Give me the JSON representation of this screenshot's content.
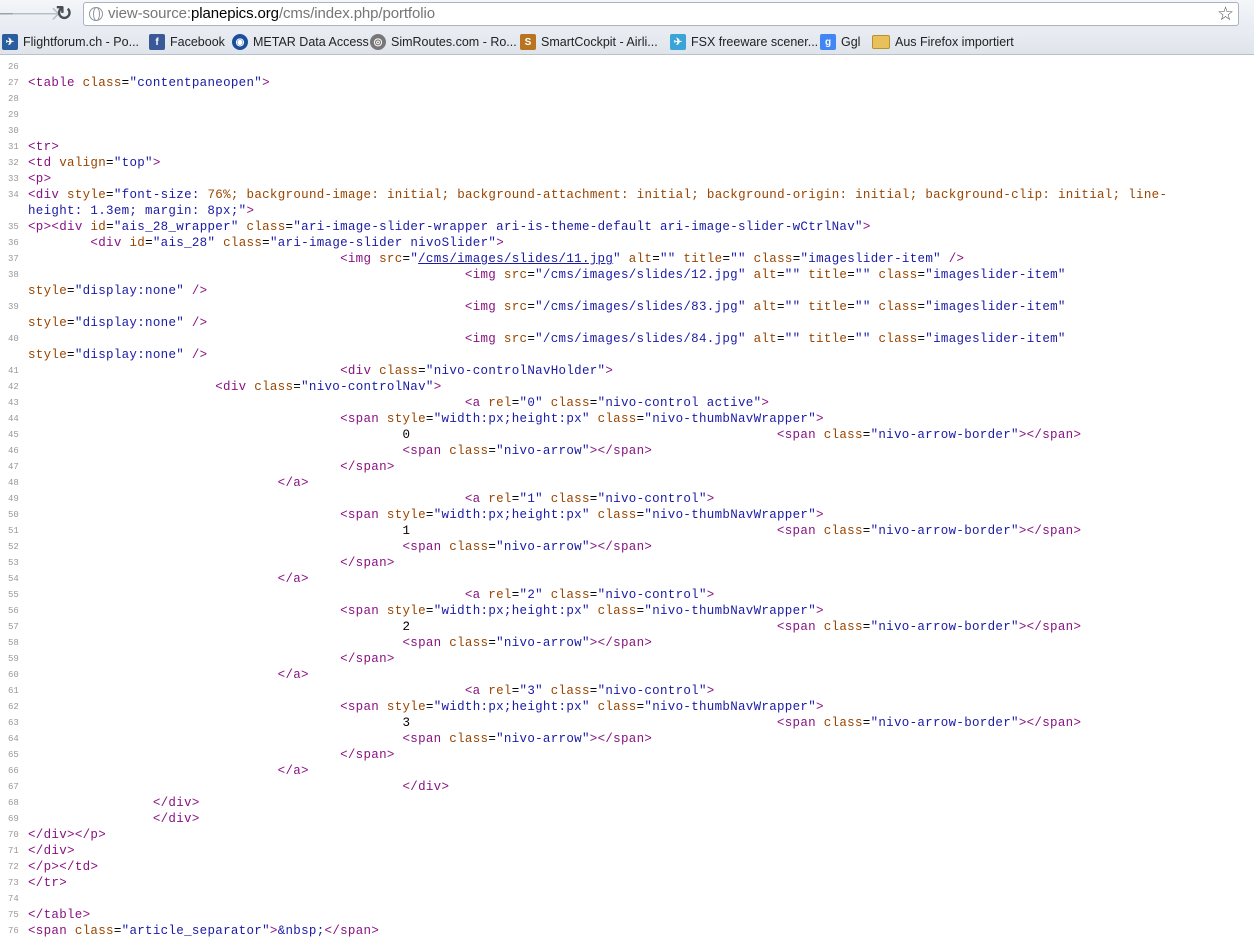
{
  "browser": {
    "url_scheme": "view-source:",
    "url_host": "planepics.org",
    "url_path": "/cms/index.php/portfolio"
  },
  "bookmarks": [
    {
      "label": "Flightforum.ch - Po...",
      "icon": "flightforum-icon",
      "color": "#2b5e9e"
    },
    {
      "label": "Facebook",
      "icon": "facebook-icon",
      "color": "#3b5998"
    },
    {
      "label": "METAR Data Access",
      "icon": "noaa-icon",
      "color": "#1b4f9c"
    },
    {
      "label": "SimRoutes.com - Ro...",
      "icon": "simroutes-icon",
      "color": "#777777"
    },
    {
      "label": "SmartCockpit - Airli...",
      "icon": "smartcockpit-icon",
      "color": "#b9741f"
    },
    {
      "label": "FSX freeware scener...",
      "icon": "fsx-icon",
      "color": "#3aa3d8"
    },
    {
      "label": "Ggl",
      "icon": "google-icon",
      "color": "#4285f4"
    },
    {
      "label": "Aus Firefox importiert",
      "icon": "folder-icon",
      "color": "#e8c15a"
    }
  ],
  "source": {
    "lines": [
      {
        "n": "26",
        "code": ""
      },
      {
        "n": "27",
        "code": "<table class=\"contentpaneopen\">"
      },
      {
        "n": "28",
        "code": ""
      },
      {
        "n": "29",
        "code": ""
      },
      {
        "n": "30",
        "code": ""
      },
      {
        "n": "31",
        "code": "<tr>"
      },
      {
        "n": "32",
        "code": "<td valign=\"top\">"
      },
      {
        "n": "33",
        "code": "<p>"
      },
      {
        "n": "34",
        "code": "<div style=\"font-size: 76%; background-image: initial; background-attachment: initial; background-origin: initial; background-clip: initial; line-"
      },
      {
        "n": "",
        "code": "height: 1.3em; margin: 8px;\">"
      },
      {
        "n": "35",
        "code": "<p><div id=\"ais_28_wrapper\" class=\"ari-image-slider-wrapper ari-is-theme-default ari-image-slider-wCtrlNav\">"
      },
      {
        "n": "36",
        "code": "        <div id=\"ais_28\" class=\"ari-image-slider nivoSlider\">"
      },
      {
        "n": "37",
        "code": "                                        <img src=\"/cms/images/slides/11.jpg\" alt=\"\" title=\"\" class=\"imageslider-item\" />"
      },
      {
        "n": "38",
        "code": "                                                        <img src=\"/cms/images/slides/12.jpg\" alt=\"\" title=\"\" class=\"imageslider-item\""
      },
      {
        "n": "",
        "code": "style=\"display:none\" />"
      },
      {
        "n": "39",
        "code": "                                                        <img src=\"/cms/images/slides/83.jpg\" alt=\"\" title=\"\" class=\"imageslider-item\""
      },
      {
        "n": "",
        "code": "style=\"display:none\" />"
      },
      {
        "n": "40",
        "code": "                                                        <img src=\"/cms/images/slides/84.jpg\" alt=\"\" title=\"\" class=\"imageslider-item\""
      },
      {
        "n": "",
        "code": "style=\"display:none\" />"
      },
      {
        "n": "41",
        "code": "                                        <div class=\"nivo-controlNavHolder\">"
      },
      {
        "n": "42",
        "code": "                        <div class=\"nivo-controlNav\">"
      },
      {
        "n": "43",
        "code": "                                                        <a rel=\"0\" class=\"nivo-control active\">"
      },
      {
        "n": "44",
        "code": "                                        <span style=\"width:px;height:px\" class=\"nivo-thumbNavWrapper\">"
      },
      {
        "n": "45",
        "code": "                                                0                                               <span class=\"nivo-arrow-border\"></span>"
      },
      {
        "n": "46",
        "code": "                                                <span class=\"nivo-arrow\"></span>"
      },
      {
        "n": "47",
        "code": "                                        </span>"
      },
      {
        "n": "48",
        "code": "                                </a>"
      },
      {
        "n": "49",
        "code": "                                                        <a rel=\"1\" class=\"nivo-control\">"
      },
      {
        "n": "50",
        "code": "                                        <span style=\"width:px;height:px\" class=\"nivo-thumbNavWrapper\">"
      },
      {
        "n": "51",
        "code": "                                                1                                               <span class=\"nivo-arrow-border\"></span>"
      },
      {
        "n": "52",
        "code": "                                                <span class=\"nivo-arrow\"></span>"
      },
      {
        "n": "53",
        "code": "                                        </span>"
      },
      {
        "n": "54",
        "code": "                                </a>"
      },
      {
        "n": "55",
        "code": "                                                        <a rel=\"2\" class=\"nivo-control\">"
      },
      {
        "n": "56",
        "code": "                                        <span style=\"width:px;height:px\" class=\"nivo-thumbNavWrapper\">"
      },
      {
        "n": "57",
        "code": "                                                2                                               <span class=\"nivo-arrow-border\"></span>"
      },
      {
        "n": "58",
        "code": "                                                <span class=\"nivo-arrow\"></span>"
      },
      {
        "n": "59",
        "code": "                                        </span>"
      },
      {
        "n": "60",
        "code": "                                </a>"
      },
      {
        "n": "61",
        "code": "                                                        <a rel=\"3\" class=\"nivo-control\">"
      },
      {
        "n": "62",
        "code": "                                        <span style=\"width:px;height:px\" class=\"nivo-thumbNavWrapper\">"
      },
      {
        "n": "63",
        "code": "                                                3                                               <span class=\"nivo-arrow-border\"></span>"
      },
      {
        "n": "64",
        "code": "                                                <span class=\"nivo-arrow\"></span>"
      },
      {
        "n": "65",
        "code": "                                        </span>"
      },
      {
        "n": "66",
        "code": "                                </a>"
      },
      {
        "n": "67",
        "code": "                                                </div>"
      },
      {
        "n": "68",
        "code": "                </div>"
      },
      {
        "n": "69",
        "code": "                </div>"
      },
      {
        "n": "70",
        "code": "</div></p>"
      },
      {
        "n": "71",
        "code": "</div>"
      },
      {
        "n": "72",
        "code": "</p></td>"
      },
      {
        "n": "73",
        "code": "</tr>"
      },
      {
        "n": "74",
        "code": ""
      },
      {
        "n": "75",
        "code": "</table>"
      },
      {
        "n": "76",
        "code": "<span class=\"article_separator\">&nbsp;</span>"
      }
    ]
  }
}
